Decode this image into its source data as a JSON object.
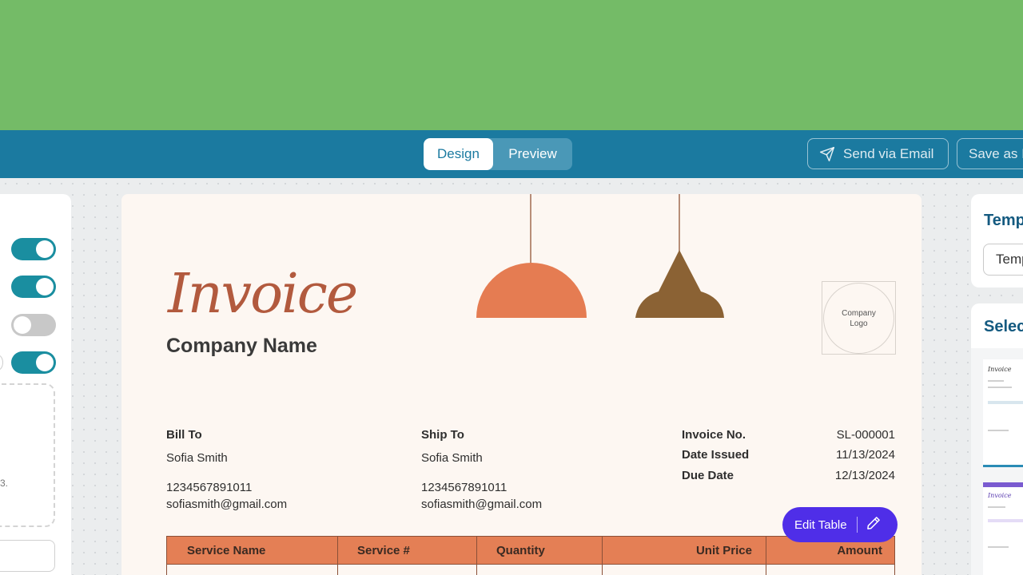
{
  "toolbar": {
    "tabs": [
      {
        "label": "Design",
        "active": true
      },
      {
        "label": "Preview",
        "active": false
      }
    ],
    "send_email_label": "Send via Email",
    "save_as_label": "Save as I",
    "send_icon": "send-paper-plane-icon"
  },
  "left_panel": {
    "toggles": [
      {
        "name": "toggle-1",
        "on": true
      },
      {
        "name": "toggle-2",
        "on": true
      },
      {
        "name": "toggle-3",
        "on": false
      },
      {
        "name": "toggle-4",
        "on": true
      }
    ],
    "fragment_text": "3."
  },
  "invoice": {
    "title": "Invoice",
    "company_name": "Company Name",
    "logo_text": "Company Logo",
    "bill_to": {
      "label": "Bill To",
      "name": "Sofia Smith",
      "phone": "1234567891011",
      "email": "sofiasmith@gmail.com"
    },
    "ship_to": {
      "label": "Ship To",
      "name": "Sofia Smith",
      "phone": "1234567891011",
      "email": "sofiasmith@gmail.com"
    },
    "meta": {
      "invoice_no_label": "Invoice No.",
      "invoice_no": "SL-000001",
      "date_issued_label": "Date Issued",
      "date_issued": "11/13/2024",
      "due_date_label": "Due Date",
      "due_date": "12/13/2024"
    },
    "table": {
      "headers": [
        "Service Name",
        "Service #",
        "Quantity",
        "Unit Price",
        "Amount"
      ]
    },
    "edit_table_label": "Edit Table",
    "colors": {
      "accent": "#e47f55",
      "title": "#b25a3e",
      "lamp_left": "#e57c52",
      "lamp_right": "#8b6234"
    }
  },
  "right_panel": {
    "template_title": "Temp",
    "template_input_value": "Temp",
    "select_title": "Selec",
    "thumb_title": "Invoice"
  },
  "colors": {
    "top_band": "#74bb67",
    "toolbar": "#1b7aa0",
    "edit_button": "#4f2ee8"
  }
}
